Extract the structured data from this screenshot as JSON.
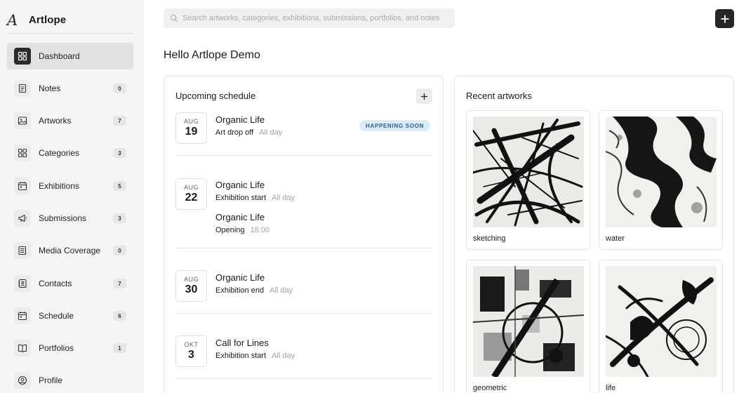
{
  "brand": {
    "name": "Artlope",
    "logo_glyph": "A"
  },
  "sidebar": {
    "items": [
      {
        "label": "Dashboard",
        "icon": "dashboard-icon",
        "badge": null,
        "active": true
      },
      {
        "label": "Notes",
        "icon": "notes-icon",
        "badge": "0"
      },
      {
        "label": "Artworks",
        "icon": "image-icon",
        "badge": "7"
      },
      {
        "label": "Categories",
        "icon": "grid-icon",
        "badge": "3"
      },
      {
        "label": "Exhibitions",
        "icon": "calendar-icon",
        "badge": "5"
      },
      {
        "label": "Submissions",
        "icon": "megaphone-icon",
        "badge": "3"
      },
      {
        "label": "Media Coverage",
        "icon": "newspaper-icon",
        "badge": "0"
      },
      {
        "label": "Contacts",
        "icon": "contacts-icon",
        "badge": "7"
      },
      {
        "label": "Schedule",
        "icon": "calendar-icon",
        "badge": "6"
      },
      {
        "label": "Portfolios",
        "icon": "book-icon",
        "badge": "1"
      },
      {
        "label": "Profile",
        "icon": "user-icon",
        "badge": null
      }
    ]
  },
  "search": {
    "placeholder": "Search artworks, categories, exhibitions, submissions, portfolios, and notes"
  },
  "greeting": "Hello Artlope Demo",
  "schedule": {
    "title": "Upcoming schedule",
    "events": [
      {
        "month": "AUG",
        "day": "19",
        "items": [
          {
            "title": "Organic Life",
            "type": "Art drop off",
            "time": "All day"
          }
        ],
        "badge": "HAPPENING SOON"
      },
      {
        "month": "AUG",
        "day": "22",
        "items": [
          {
            "title": "Organic Life",
            "type": "Exhibition start",
            "time": "All day"
          },
          {
            "title": "Organic Life",
            "type": "Opening",
            "time": "18:00"
          }
        ]
      },
      {
        "month": "AUG",
        "day": "30",
        "items": [
          {
            "title": "Organic Life",
            "type": "Exhibition end",
            "time": "All day"
          }
        ]
      },
      {
        "month": "OKT",
        "day": "3",
        "items": [
          {
            "title": "Call for Lines",
            "type": "Exhibition start",
            "time": "All day"
          }
        ]
      }
    ]
  },
  "artworks": {
    "title": "Recent artworks",
    "items": [
      {
        "label": "sketching"
      },
      {
        "label": "water"
      },
      {
        "label": "geometric"
      },
      {
        "label": "life"
      }
    ]
  },
  "colors": {
    "accent_dark": "#262626",
    "badge_bg": "#dcebf8",
    "badge_text": "#2c5e8c",
    "sidebar_bg": "#f5f5f4"
  }
}
